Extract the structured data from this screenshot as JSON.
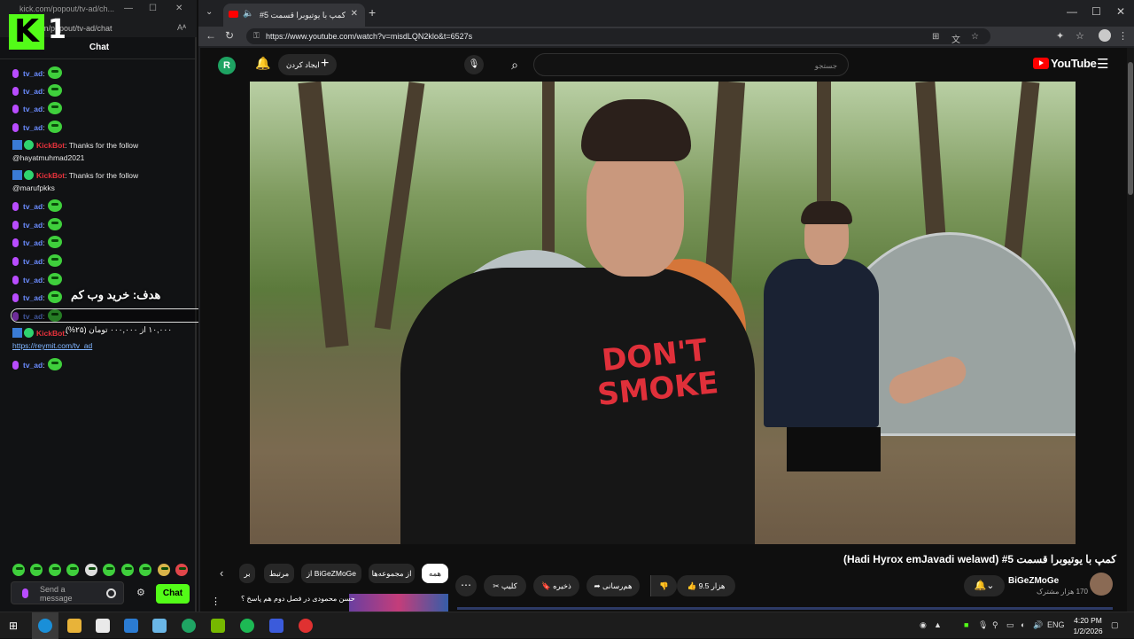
{
  "chat_window": {
    "titlebar_url": "kick.com/popout/tv-ad/ch...",
    "url": "om/popout/tv-ad/chat",
    "logo_letter": "K",
    "logo_number": "1",
    "header": "Chat",
    "messages": [
      {
        "user": "tv_ad",
        "text": ":"
      },
      {
        "user": "tv_ad",
        "text": ":"
      },
      {
        "user": "tv_ad",
        "text": ":"
      },
      {
        "user": "tv_ad",
        "text": ":"
      },
      {
        "user": "KickBot",
        "text": ": Thanks for the follow",
        "line2": "@hayatmuhmad2021"
      },
      {
        "user": "KickBot",
        "text": ": Thanks for the follow",
        "line2": "@marufpkks"
      },
      {
        "user": "tv_ad",
        "text": ":"
      },
      {
        "user": "tv_ad",
        "text": ":"
      },
      {
        "user": "tv_ad",
        "text": ":"
      },
      {
        "user": "tv_ad",
        "text": ":"
      },
      {
        "user": "tv_ad",
        "text": ":"
      },
      {
        "user": "tv_ad",
        "text": ":"
      },
      {
        "user": "tv_ad",
        "text": ":"
      },
      {
        "user": "KickBot",
        "text": ":",
        "line2": "https://reymit.com/tv_ad"
      },
      {
        "user": "tv_ad",
        "text": ":"
      }
    ],
    "goal_title": "هدف: خرید وب کم",
    "goal_percent": "%۰",
    "goal_progress": 0,
    "goal_amount": "۱۰,۰۰۰ از ۰۰۰,۰۰۰ تومان (۲۵%)",
    "input_placeholder": "Send a message",
    "send_label": "Chat"
  },
  "browser": {
    "tab_title": "کمپ با یوتیوبرا قسمت 5#",
    "url": "https://www.youtube.com/watch?v=misdLQN2klo&t=6527s"
  },
  "youtube": {
    "avatar_letter": "R",
    "create_label": "ایجاد کردن",
    "search_placeholder": "جستجو",
    "logo_text": "YouTube",
    "video_title": "کمپ با یوتیوبرا قسمت 5#  (Hadi Hyrox emJavadi welawd)",
    "channel_name": "BiGeZMoGe",
    "channel_subs": "170 هزار مشترک",
    "likes_label": "9.5 هزار",
    "share_label": "هم‌رسانی",
    "save_label": "ذخیره",
    "clip_label": "کلیپ",
    "chips": [
      {
        "label": "همه",
        "active": true
      },
      {
        "label": "از مجموعه‌ها",
        "active": false
      },
      {
        "label": "از BiGeZMoGe",
        "active": false
      },
      {
        "label": "مرتبط",
        "active": false
      },
      {
        "label": "بر",
        "active": false
      }
    ],
    "up_next_title": "حسن محمودی در فصل دوم هم پاسخ ؟"
  },
  "taskbar": {
    "lang": "ENG",
    "time": "4:20 PM",
    "date": "1/2/2026"
  },
  "colors": {
    "kick_green": "#53fc18",
    "youtube_red": "#ff0000",
    "bot_red": "#e8323c",
    "user_blue": "#6b8cff"
  }
}
